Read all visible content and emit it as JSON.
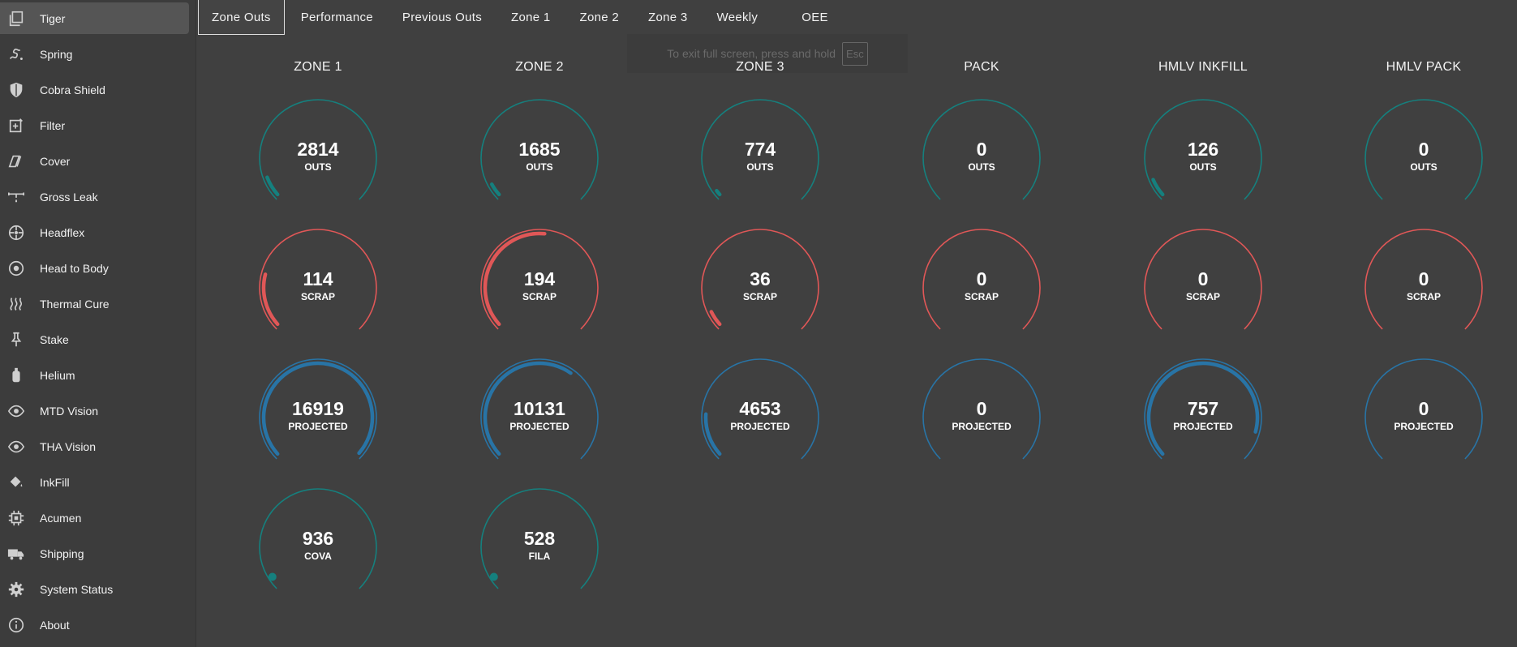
{
  "sidebar": {
    "items": [
      {
        "label": "Tiger",
        "icon": "copy-icon"
      },
      {
        "label": "Spring",
        "icon": "spring-icon"
      },
      {
        "label": "Cobra Shield",
        "icon": "shield-icon"
      },
      {
        "label": "Filter",
        "icon": "filter-icon"
      },
      {
        "label": "Cover",
        "icon": "cover-icon"
      },
      {
        "label": "Gross Leak",
        "icon": "leak-icon"
      },
      {
        "label": "Headflex",
        "icon": "wheel-icon"
      },
      {
        "label": "Head to Body",
        "icon": "target-icon"
      },
      {
        "label": "Thermal Cure",
        "icon": "heat-icon"
      },
      {
        "label": "Stake",
        "icon": "pin-icon"
      },
      {
        "label": "Helium",
        "icon": "tank-icon"
      },
      {
        "label": "MTD Vision",
        "icon": "eye-icon"
      },
      {
        "label": "THA Vision",
        "icon": "eye-icon"
      },
      {
        "label": "InkFill",
        "icon": "paint-bucket-icon"
      },
      {
        "label": "Acumen",
        "icon": "chip-icon"
      },
      {
        "label": "Shipping",
        "icon": "truck-icon"
      },
      {
        "label": "System Status",
        "icon": "gear-icon"
      },
      {
        "label": "About",
        "icon": "info-icon"
      }
    ]
  },
  "tabs": [
    "Zone Outs",
    "Performance",
    "Previous Outs",
    "Zone 1",
    "Zone 2",
    "Zone 3",
    "Weekly",
    "OEE"
  ],
  "fullscreen": {
    "message": "To exit full screen, press and hold",
    "key": "Esc"
  },
  "colors": {
    "outs": "#15807e",
    "scrap": "#e05757",
    "projected": "#2874a6"
  },
  "columns": [
    "ZONE 1",
    "ZONE 2",
    "ZONE 3",
    "PACK",
    "HMLV INKFILL",
    "HMLV PACK"
  ],
  "gauges": {
    "outs": [
      {
        "value": "2814",
        "label": "OUTS",
        "fill": 0.09
      },
      {
        "value": "1685",
        "label": "OUTS",
        "fill": 0.06
      },
      {
        "value": "774",
        "label": "OUTS",
        "fill": 0.03
      },
      {
        "value": "0",
        "label": "OUTS",
        "fill": 0
      },
      {
        "value": "126",
        "label": "OUTS",
        "fill": 0.08
      },
      {
        "value": "0",
        "label": "OUTS",
        "fill": 0
      }
    ],
    "scrap": [
      {
        "value": "114",
        "label": "SCRAP",
        "fill": 0.22
      },
      {
        "value": "194",
        "label": "SCRAP",
        "fill": 0.52
      },
      {
        "value": "36",
        "label": "SCRAP",
        "fill": 0.07
      },
      {
        "value": "0",
        "label": "SCRAP",
        "fill": 0
      },
      {
        "value": "0",
        "label": "SCRAP",
        "fill": 0
      },
      {
        "value": "0",
        "label": "SCRAP",
        "fill": 0
      }
    ],
    "projected": [
      {
        "value": "16919",
        "label": "PROJECTED",
        "fill": 1.0
      },
      {
        "value": "10131",
        "label": "PROJECTED",
        "fill": 0.63
      },
      {
        "value": "4653",
        "label": "PROJECTED",
        "fill": 0.18
      },
      {
        "value": "0",
        "label": "PROJECTED",
        "fill": 0
      },
      {
        "value": "757",
        "label": "PROJECTED",
        "fill": 0.89
      },
      {
        "value": "0",
        "label": "PROJECTED",
        "fill": 0
      }
    ],
    "extra": [
      {
        "value": "936",
        "label": "COVA",
        "fill": 0.0
      },
      {
        "value": "528",
        "label": "FILA",
        "fill": 0.0
      }
    ]
  }
}
